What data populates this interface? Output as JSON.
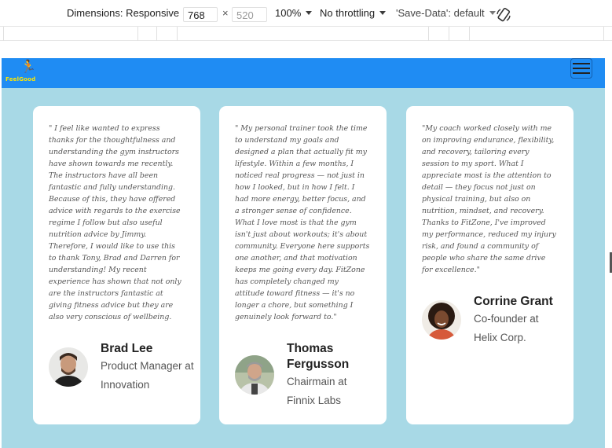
{
  "devtools": {
    "dimensions_label": "Dimensions: Responsive",
    "width_value": "768",
    "times_sign": "×",
    "height_placeholder": "520",
    "zoom": "100%",
    "throttling": "No throttling",
    "save_data": "'Save-Data': default"
  },
  "site": {
    "brand": "FeelGood",
    "nav_color": "#1f8cf3",
    "page_bg": "#a8d9e6"
  },
  "testimonials": [
    {
      "quote": "\" I feel like wanted to express thanks for the thoughtfulness and understanding the gym instructors have shown towards me recently. The instructors have all been fantastic and fully understanding. Because of this, they have offered advice with regards to the exercise regime I follow but also useful nutrition advice by Jimmy. Therefore, I would like to use this to thank Tony, Brad and Darren for understanding! My recent experience has shown that not only are the instructors fantastic at giving fitness advice but they are also very conscious of wellbeing.",
      "name": "Brad Lee",
      "role": "Product Manager at Innovation"
    },
    {
      "quote": "\" My personal trainer took the time to understand my goals and designed a plan that actually fit my lifestyle. Within a few months, I noticed real progress — not just in how I looked, but in how I felt. I had more energy, better focus, and a stronger sense of confidence. What I love most is that the gym isn't just about workouts; it's about community. Everyone here supports one another, and that motivation keeps me going every day. FitZone has completely changed my attitude toward fitness — it's no longer a chore, but something I genuinely look forward to.\"",
      "name": "Thomas Fergusson",
      "role": "Chairmain at Finnix Labs"
    },
    {
      "quote": "\"My coach worked closely with me on improving endurance, flexibility, and recovery, tailoring every session to my sport. What I appreciate most is the attention to detail — they focus not just on physical training, but also on nutrition, mindset, and recovery. Thanks to FitZone, I've improved my performance, reduced my injury risk, and found a community of people who share the same drive for excellence.\"",
      "name": "Corrine Grant",
      "role": "Co-founder at Helix Corp."
    }
  ]
}
